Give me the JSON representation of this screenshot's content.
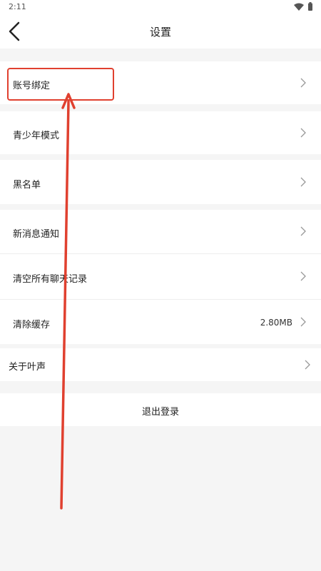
{
  "status_bar": {
    "time": "2:11"
  },
  "header": {
    "title": "设置"
  },
  "settings": [
    {
      "label": "账号绑定",
      "value": ""
    },
    {
      "label": "青少年模式",
      "value": ""
    },
    {
      "label": "黑名单",
      "value": ""
    },
    {
      "label": "新消息通知",
      "value": ""
    },
    {
      "label": "清空所有聊天记录",
      "value": ""
    },
    {
      "label": "清除缓存",
      "value": "2.80MB"
    },
    {
      "label": "关于叶声",
      "value": ""
    }
  ],
  "logout": {
    "label": "退出登录"
  },
  "colors": {
    "annotation": "#e0402f",
    "background": "#f5f5f5",
    "surface": "#ffffff"
  }
}
